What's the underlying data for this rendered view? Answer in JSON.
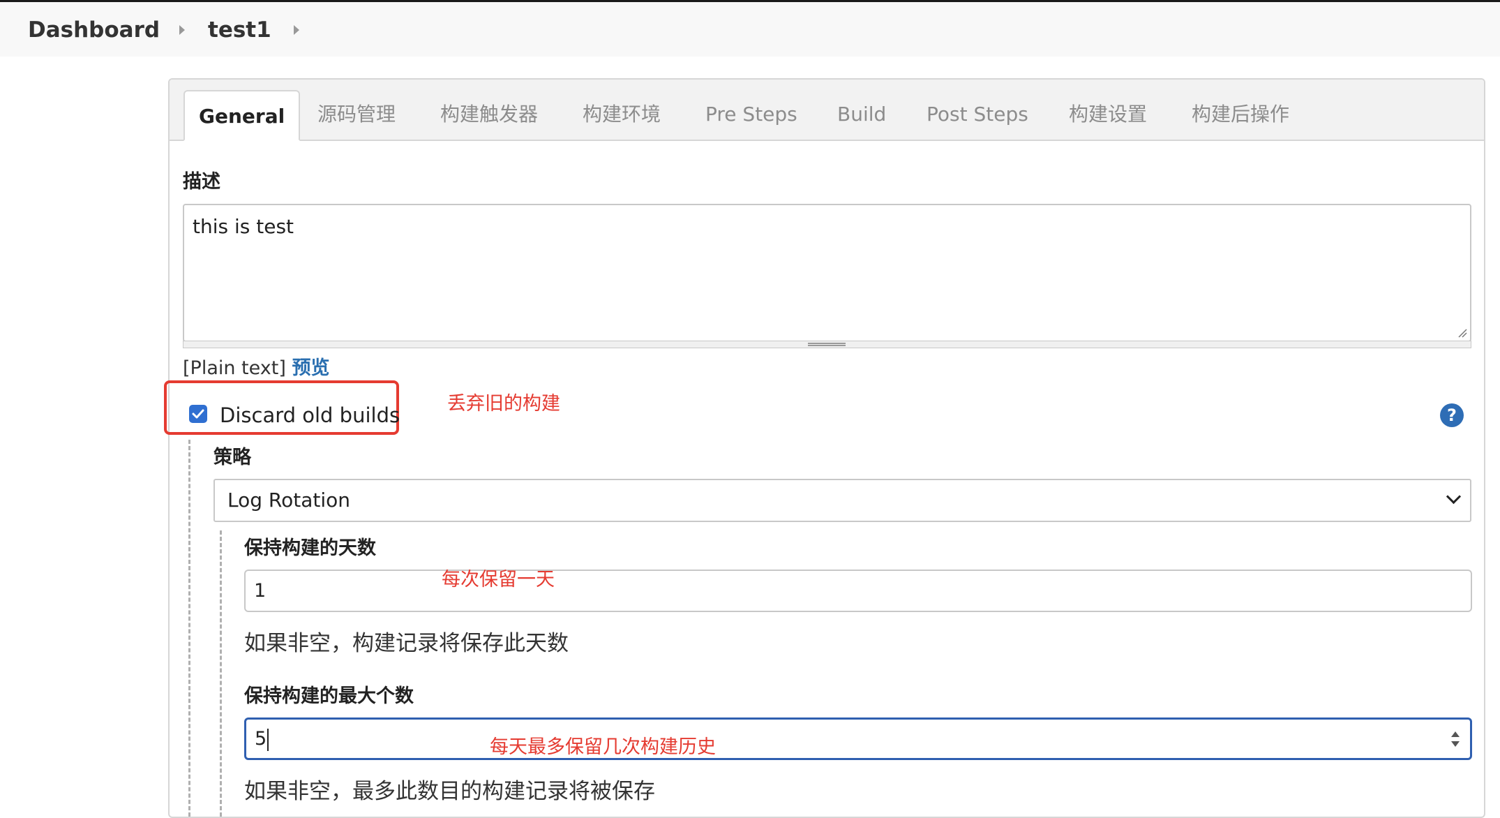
{
  "breadcrumb": {
    "items": [
      "Dashboard",
      "test1"
    ]
  },
  "tabs": [
    "General",
    "源码管理",
    "构建触发器",
    "构建环境",
    "Pre Steps",
    "Build",
    "Post Steps",
    "构建设置",
    "构建后操作"
  ],
  "description": {
    "label": "描述",
    "value": "this is test",
    "format_label": "[Plain text]",
    "preview_link": "预览"
  },
  "discard": {
    "checked": true,
    "label": "Discard old builds",
    "annotation": "丢弃旧的构建",
    "help": "?"
  },
  "strategy": {
    "label": "策略",
    "selected": "Log Rotation"
  },
  "days_to_keep": {
    "label": "保持构建的天数",
    "value": "1",
    "annotation": "每次保留一天",
    "hint": "如果非空，构建记录将保存此天数"
  },
  "max_builds": {
    "label": "保持构建的最大个数",
    "value": "5",
    "annotation": "每天最多保留几次构建历史",
    "hint": "如果非空，最多此数目的构建记录将被保存"
  },
  "colors": {
    "annotation_red": "#e53b31",
    "link_blue": "#2a6fb0",
    "focus_blue": "#2f5fb0",
    "checkbox_blue": "#2f6fd1"
  }
}
